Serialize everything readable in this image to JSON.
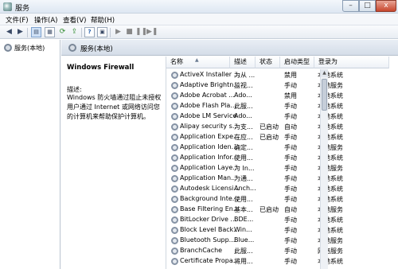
{
  "window": {
    "title": "服务",
    "controls": {
      "minimize": "–",
      "maximize": "□",
      "close": "x"
    }
  },
  "menu": [
    "文件(F)",
    "操作(A)",
    "查看(V)",
    "帮助(H)"
  ],
  "toolbar": {
    "icons": [
      "back-arrow-icon",
      "forward-arrow-icon",
      "console-tree-icon",
      "properties-icon",
      "refresh-icon",
      "export-icon",
      "help-icon",
      "view-icon",
      "play-icon",
      "stop-icon",
      "pause-icon",
      "restart-icon"
    ]
  },
  "tree": {
    "root": "服务(本地)"
  },
  "main": {
    "header": "服务(本地)",
    "selected_service": "Windows Firewall",
    "desc_label": "描述:",
    "description": "Windows 防火墙通过阻止未授权用户通过 Internet 或网络访问您的计算机来帮助保护计算机。"
  },
  "list": {
    "columns": [
      "名称",
      "描述",
      "状态",
      "启动类型",
      "登录为"
    ],
    "rows": [
      {
        "name": "ActiveX Installer ...",
        "desc": "为从 ...",
        "status": "",
        "startup": "禁用",
        "logon": "本地系统"
      },
      {
        "name": "Adaptive Brightn...",
        "desc": "监视...",
        "status": "",
        "startup": "手动",
        "logon": "本地服务"
      },
      {
        "name": "Adobe Acrobat ...",
        "desc": "Ado...",
        "status": "",
        "startup": "禁用",
        "logon": "本地系统"
      },
      {
        "name": "Adobe Flash Pla...",
        "desc": "此服...",
        "status": "",
        "startup": "手动",
        "logon": "本地系统"
      },
      {
        "name": "Adobe LM Service",
        "desc": "Ado...",
        "status": "",
        "startup": "手动",
        "logon": "本地系统"
      },
      {
        "name": "Alipay security s...",
        "desc": "为支...",
        "status": "已启动",
        "startup": "自动",
        "logon": "本地系统"
      },
      {
        "name": "Application Expe...",
        "desc": "在应...",
        "status": "已启动",
        "startup": "手动",
        "logon": "本地系统"
      },
      {
        "name": "Application Iden...",
        "desc": "确定...",
        "status": "",
        "startup": "手动",
        "logon": "本地服务"
      },
      {
        "name": "Application Infor...",
        "desc": "使用...",
        "status": "",
        "startup": "手动",
        "logon": "本地系统"
      },
      {
        "name": "Application Laye...",
        "desc": "为 In...",
        "status": "",
        "startup": "手动",
        "logon": "本地服务"
      },
      {
        "name": "Application Man...",
        "desc": "为通...",
        "status": "",
        "startup": "手动",
        "logon": "本地系统"
      },
      {
        "name": "Autodesk Licensi...",
        "desc": "Anch...",
        "status": "",
        "startup": "手动",
        "logon": "本地系统"
      },
      {
        "name": "Background Inte...",
        "desc": "使用...",
        "status": "",
        "startup": "手动",
        "logon": "本地系统"
      },
      {
        "name": "Base Filtering En...",
        "desc": "基本...",
        "status": "已启动",
        "startup": "自动",
        "logon": "本地服务"
      },
      {
        "name": "BitLocker Drive ...",
        "desc": "BDE...",
        "status": "",
        "startup": "手动",
        "logon": "本地系统"
      },
      {
        "name": "Block Level Back...",
        "desc": "Win...",
        "status": "",
        "startup": "手动",
        "logon": "本地系统"
      },
      {
        "name": "Bluetooth Supp...",
        "desc": "Blue...",
        "status": "",
        "startup": "手动",
        "logon": "本地服务"
      },
      {
        "name": "BranchCache",
        "desc": "此服...",
        "status": "",
        "startup": "手动",
        "logon": "网络服务"
      },
      {
        "name": "Certificate Propa...",
        "desc": "将用...",
        "status": "",
        "startup": "手动",
        "logon": "本地系统"
      }
    ]
  }
}
